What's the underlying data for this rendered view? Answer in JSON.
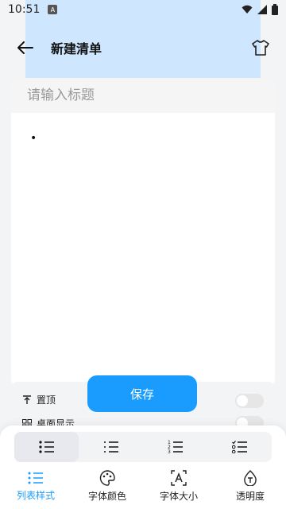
{
  "status_bar": {
    "time": "10:51",
    "notification": "A"
  },
  "header": {
    "title": "新建清单"
  },
  "editor": {
    "title_placeholder": "请输入标题",
    "bullet": "•"
  },
  "options": {
    "pin_label": "置顶",
    "desktop_label": "桌面显示"
  },
  "save_label": "保存",
  "bottom_tabs": [
    {
      "label": "列表样式",
      "icon": "list-style-icon"
    },
    {
      "label": "字体颜色",
      "icon": "palette-icon"
    },
    {
      "label": "字体大小",
      "icon": "font-size-icon"
    },
    {
      "label": "透明度",
      "icon": "transparency-icon"
    }
  ],
  "colors": {
    "accent": "#1a9cff",
    "hero": "#cfe6ff"
  }
}
